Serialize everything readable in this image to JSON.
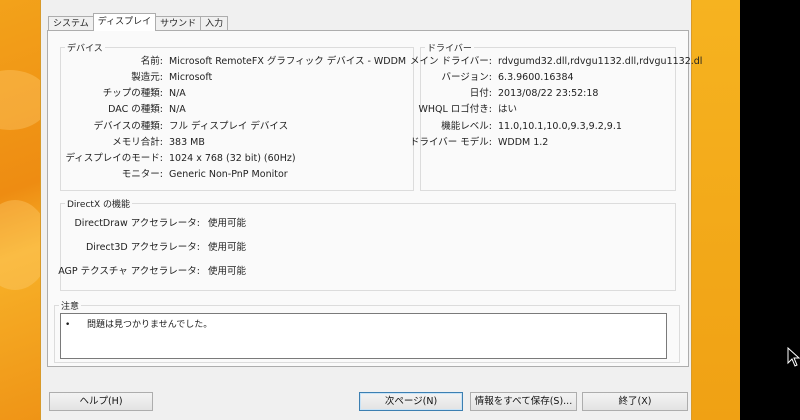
{
  "tabs": [
    {
      "label": "システム",
      "active": false
    },
    {
      "label": "ディスプレイ",
      "active": true
    },
    {
      "label": "サウンド",
      "active": false
    },
    {
      "label": "入力",
      "active": false
    }
  ],
  "device": {
    "legend": "デバイス",
    "rows": [
      {
        "label": "名前:",
        "value": "Microsoft RemoteFX グラフィック デバイス - WDDM"
      },
      {
        "label": "製造元:",
        "value": "Microsoft"
      },
      {
        "label": "チップの種類:",
        "value": "N/A"
      },
      {
        "label": "DAC の種類:",
        "value": "N/A"
      },
      {
        "label": "デバイスの種類:",
        "value": "フル ディスプレイ デバイス"
      },
      {
        "label": "メモリ合計:",
        "value": "383 MB"
      },
      {
        "label": "ディスプレイのモード:",
        "value": "1024 x 768 (32 bit) (60Hz)"
      },
      {
        "label": "モニター:",
        "value": "Generic Non-PnP Monitor"
      }
    ]
  },
  "driver": {
    "legend": "ドライバー",
    "rows": [
      {
        "label": "メイン ドライバー:",
        "value": "rdvgumd32.dll,rdvgu1132.dll,rdvgu1132.dl"
      },
      {
        "label": "バージョン:",
        "value": "6.3.9600.16384"
      },
      {
        "label": "日付:",
        "value": "2013/08/22 23:52:18"
      },
      {
        "label": "WHQL ロゴ付き:",
        "value": "はい"
      },
      {
        "label": "機能レベル:",
        "value": "11.0,10.1,10.0,9.3,9.2,9.1"
      },
      {
        "label": "ドライバー モデル:",
        "value": "WDDM 1.2"
      }
    ]
  },
  "directx": {
    "legend": "DirectX の機能",
    "rows": [
      {
        "label": "DirectDraw アクセラレータ:",
        "value": "使用可能"
      },
      {
        "label": "Direct3D アクセラレータ:",
        "value": "使用可能"
      },
      {
        "label": "AGP テクスチャ アクセラレータ:",
        "value": "使用可能"
      }
    ]
  },
  "notes": {
    "legend": "注意",
    "items": [
      "問題は見つかりませんでした。"
    ]
  },
  "buttons": {
    "help": "ヘルプ(H)",
    "next": "次ページ(N)",
    "save_all": "情報をすべて保存(S)...",
    "exit": "終了(X)"
  },
  "colors": {
    "desktop_orange": "#f5a81c",
    "dialog_bg": "#f0f0f0",
    "default_button_border": "#3c7fb1"
  }
}
